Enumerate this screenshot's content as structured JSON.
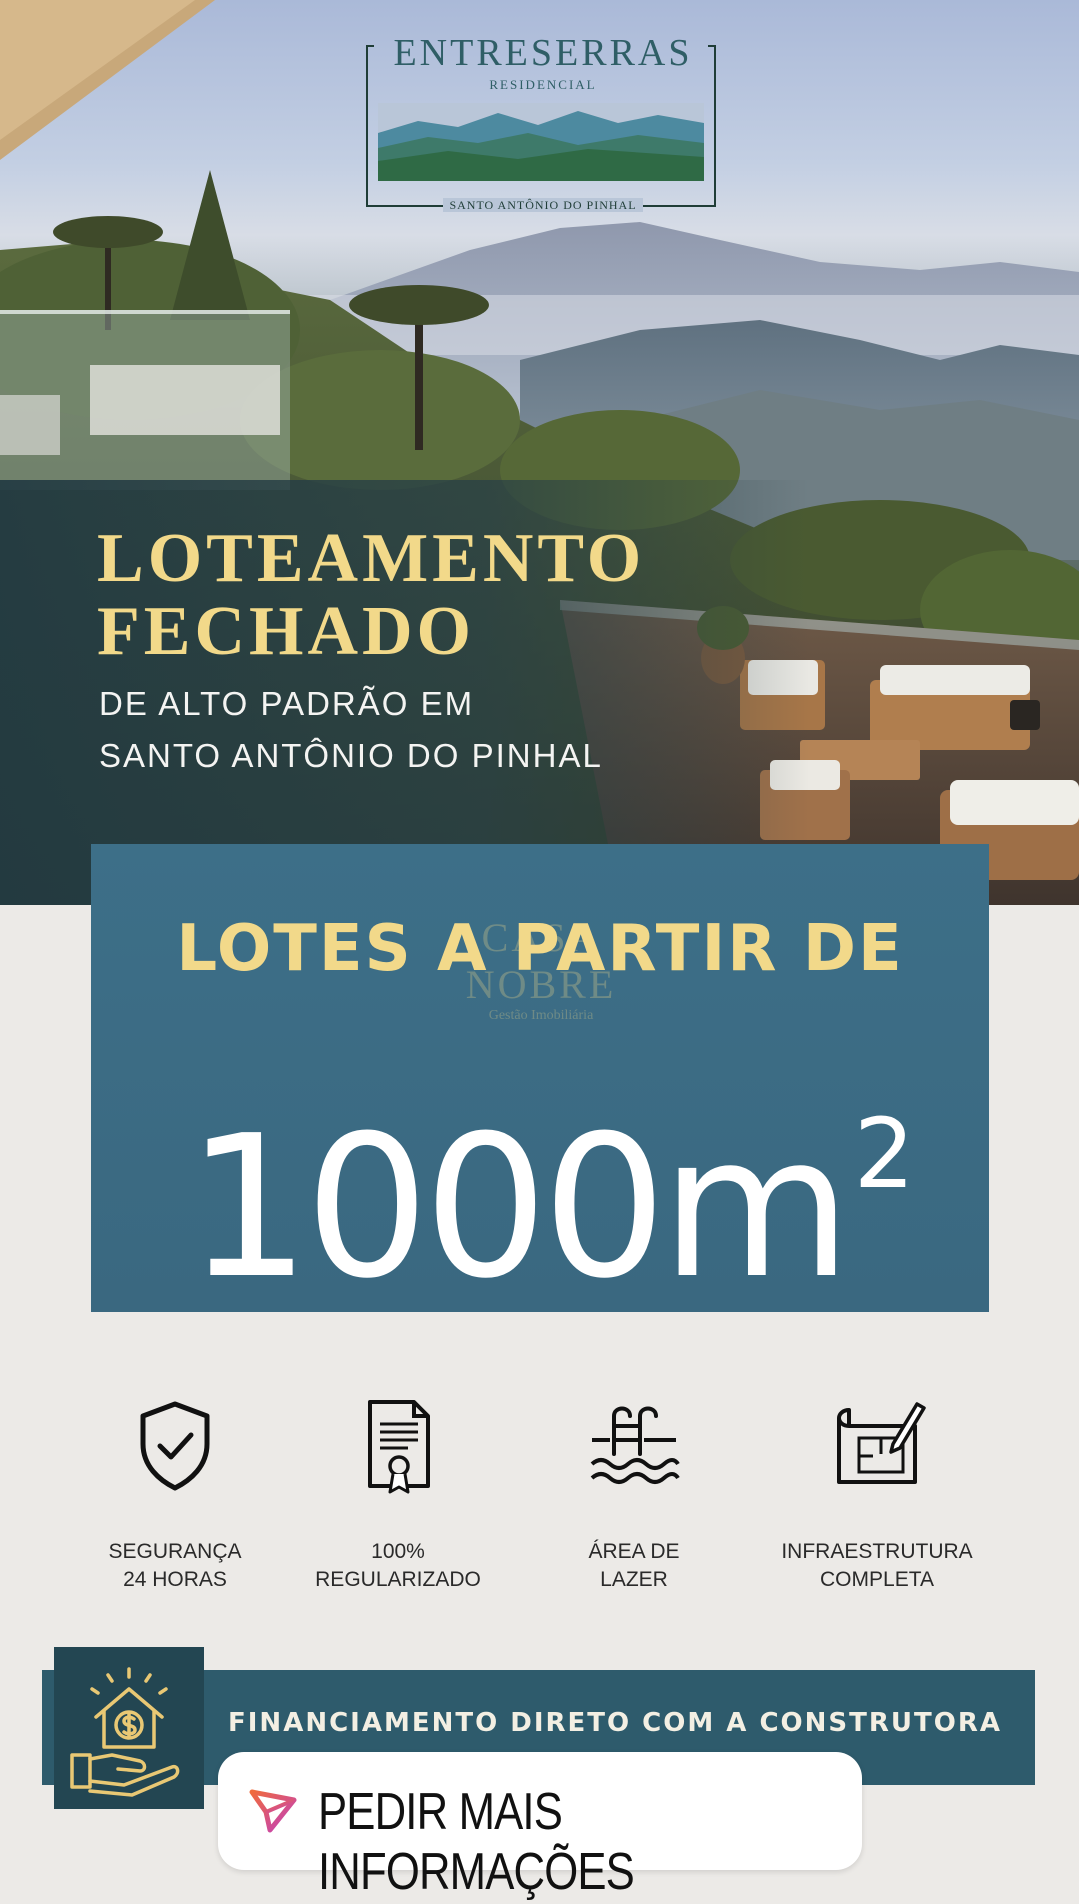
{
  "brand": {
    "name": "ENTRESERRAS",
    "subtitle": "RESIDENCIAL",
    "location": "SANTO ANTÔNIO DO PINHAL"
  },
  "hero": {
    "headline_line1": "LOTEAMENTO",
    "headline_line2": "FECHADO",
    "subline_line1": "DE ALTO PADRÃO EM",
    "subline_line2": "SANTO ANTÔNIO DO PINHAL"
  },
  "promo": {
    "title": "LOTES A PARTIR DE",
    "area_value": "1000m",
    "area_exponent": "2",
    "watermark_name": "CASA NOBRE",
    "watermark_sub": "Gestão Imobiliária"
  },
  "features": [
    {
      "icon": "shield-check-icon",
      "line1": "SEGURANÇA",
      "line2": "24 HORAS"
    },
    {
      "icon": "certificate-document-icon",
      "line1": "100%",
      "line2": "REGULARIZADO"
    },
    {
      "icon": "pool-ladder-icon",
      "line1": "ÁREA DE",
      "line2": "LAZER"
    },
    {
      "icon": "blueprint-pencil-icon",
      "line1": "INFRAESTRUTURA",
      "line2": "COMPLETA"
    }
  ],
  "banner": {
    "text": "FINANCIAMENTO DIRETO COM A CONSTRUTORA",
    "icon": "house-money-hand-icon"
  },
  "cta": {
    "label": "PEDIR MAIS INFORMAÇÕES",
    "icon": "send-arrow-icon"
  },
  "colors": {
    "gold": "#f2d98a",
    "teal": "#3d6f88",
    "banner": "#2e5b6c",
    "cta_gradient_start": "#f06a3c",
    "cta_gradient_end": "#c13fbf"
  }
}
